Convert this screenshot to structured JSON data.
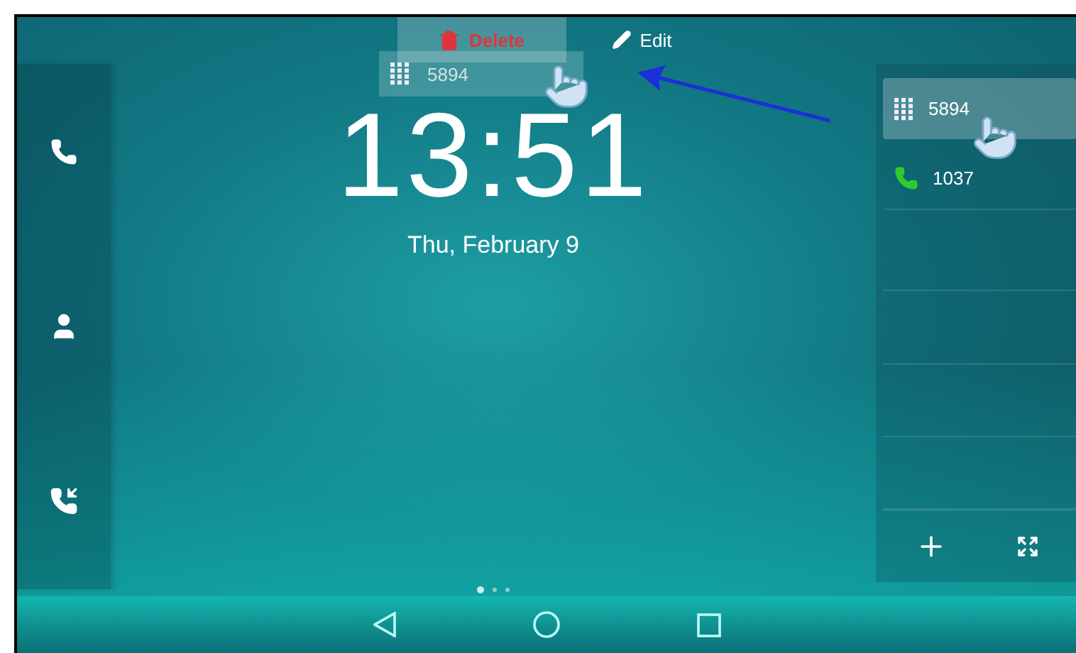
{
  "drop_targets": [
    {
      "kind": "delete",
      "label": "Delete",
      "selected": true
    },
    {
      "kind": "edit",
      "label": "Edit",
      "selected": false
    }
  ],
  "dragged_key": {
    "kind": "speed_dial",
    "label": "5894"
  },
  "clock": {
    "time": "13:51",
    "date": "Thu, February 9"
  },
  "sidebar": {
    "items": [
      {
        "kind": "phone"
      },
      {
        "kind": "contacts"
      },
      {
        "kind": "history"
      }
    ]
  },
  "dsskeys": [
    {
      "kind": "speed_dial",
      "label": "5894",
      "selected": true
    },
    {
      "kind": "line",
      "label": "1037",
      "selected": false
    }
  ],
  "page_indicator": [
    {
      "selected": true
    },
    {
      "selected": false
    },
    {
      "selected": false
    }
  ]
}
